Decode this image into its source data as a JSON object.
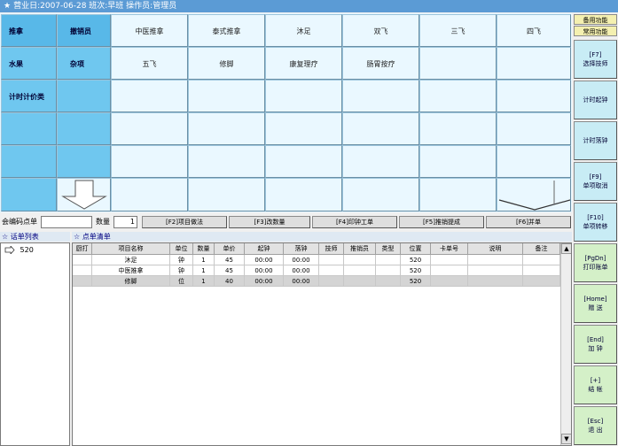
{
  "titlebar": {
    "text": "营业日:2007-06-28 班次:早班 操作员:管理员"
  },
  "category_left": {
    "col1": [
      "推拿",
      "水果",
      "计时计价类"
    ],
    "col2": [
      "撤销员",
      "杂项"
    ]
  },
  "service_rows": [
    [
      "中医推拿",
      "泰式推拿",
      "沐足",
      "双飞",
      "三飞",
      "四飞"
    ],
    [
      "五飞",
      "修脚",
      "康复理疗",
      "肠胃按疗",
      "",
      ""
    ]
  ],
  "input_bar": {
    "code_label": "会编码点单",
    "qty_label": "数量",
    "qty_value": "1",
    "buttons": [
      "[F2]项目做法",
      "[F3]改数量",
      "[F4]印钟工单",
      "[F5]推销提成",
      "[F6]并单"
    ]
  },
  "order_list": {
    "title": "☆ 话单列表",
    "items": [
      "520"
    ]
  },
  "order_detail": {
    "title": "☆ 点单清单",
    "columns": [
      "厨打",
      "项目名称",
      "单位",
      "数量",
      "单价",
      "起钟",
      "落钟",
      "技师",
      "推销员",
      "类型",
      "位置",
      "卡单号",
      "说明",
      "备注"
    ],
    "rows": [
      [
        "",
        "沐足",
        "钟",
        "1",
        "45",
        "00:00",
        "00:00",
        "",
        "",
        "",
        "520",
        "",
        "",
        ""
      ],
      [
        "",
        "中医推拿",
        "钟",
        "1",
        "45",
        "00:00",
        "00:00",
        "",
        "",
        "",
        "520",
        "",
        "",
        ""
      ],
      [
        "",
        "修脚",
        "位",
        "1",
        "40",
        "00:00",
        "00:00",
        "",
        "",
        "",
        "520",
        "",
        "",
        ""
      ]
    ]
  },
  "sidebar": {
    "tabs": [
      "备用功能",
      "常用功能"
    ],
    "buttons": [
      {
        "key": "[F7]",
        "label": "选择技师"
      },
      {
        "key": "",
        "label": "计时起钟"
      },
      {
        "key": "",
        "label": "计时落钟"
      },
      {
        "key": "[F9]",
        "label": "单项取消"
      },
      {
        "key": "[F10]",
        "label": "单项转移"
      },
      {
        "key": "[PgDn]",
        "label": "打印账单"
      },
      {
        "key": "[Home]",
        "label": "赠 送"
      },
      {
        "key": "[End]",
        "label": "加 钟"
      },
      {
        "key": "[+]",
        "label": "结 帐"
      },
      {
        "key": "[Esc]",
        "label": "退 出"
      }
    ]
  },
  "colors": {
    "title_bg": "#5b9bd5",
    "category_blue": "#6fc7ef",
    "service_cell": "#eaf8ff",
    "side_blue": "#c8ecf5",
    "side_green": "#d4f0c8"
  }
}
